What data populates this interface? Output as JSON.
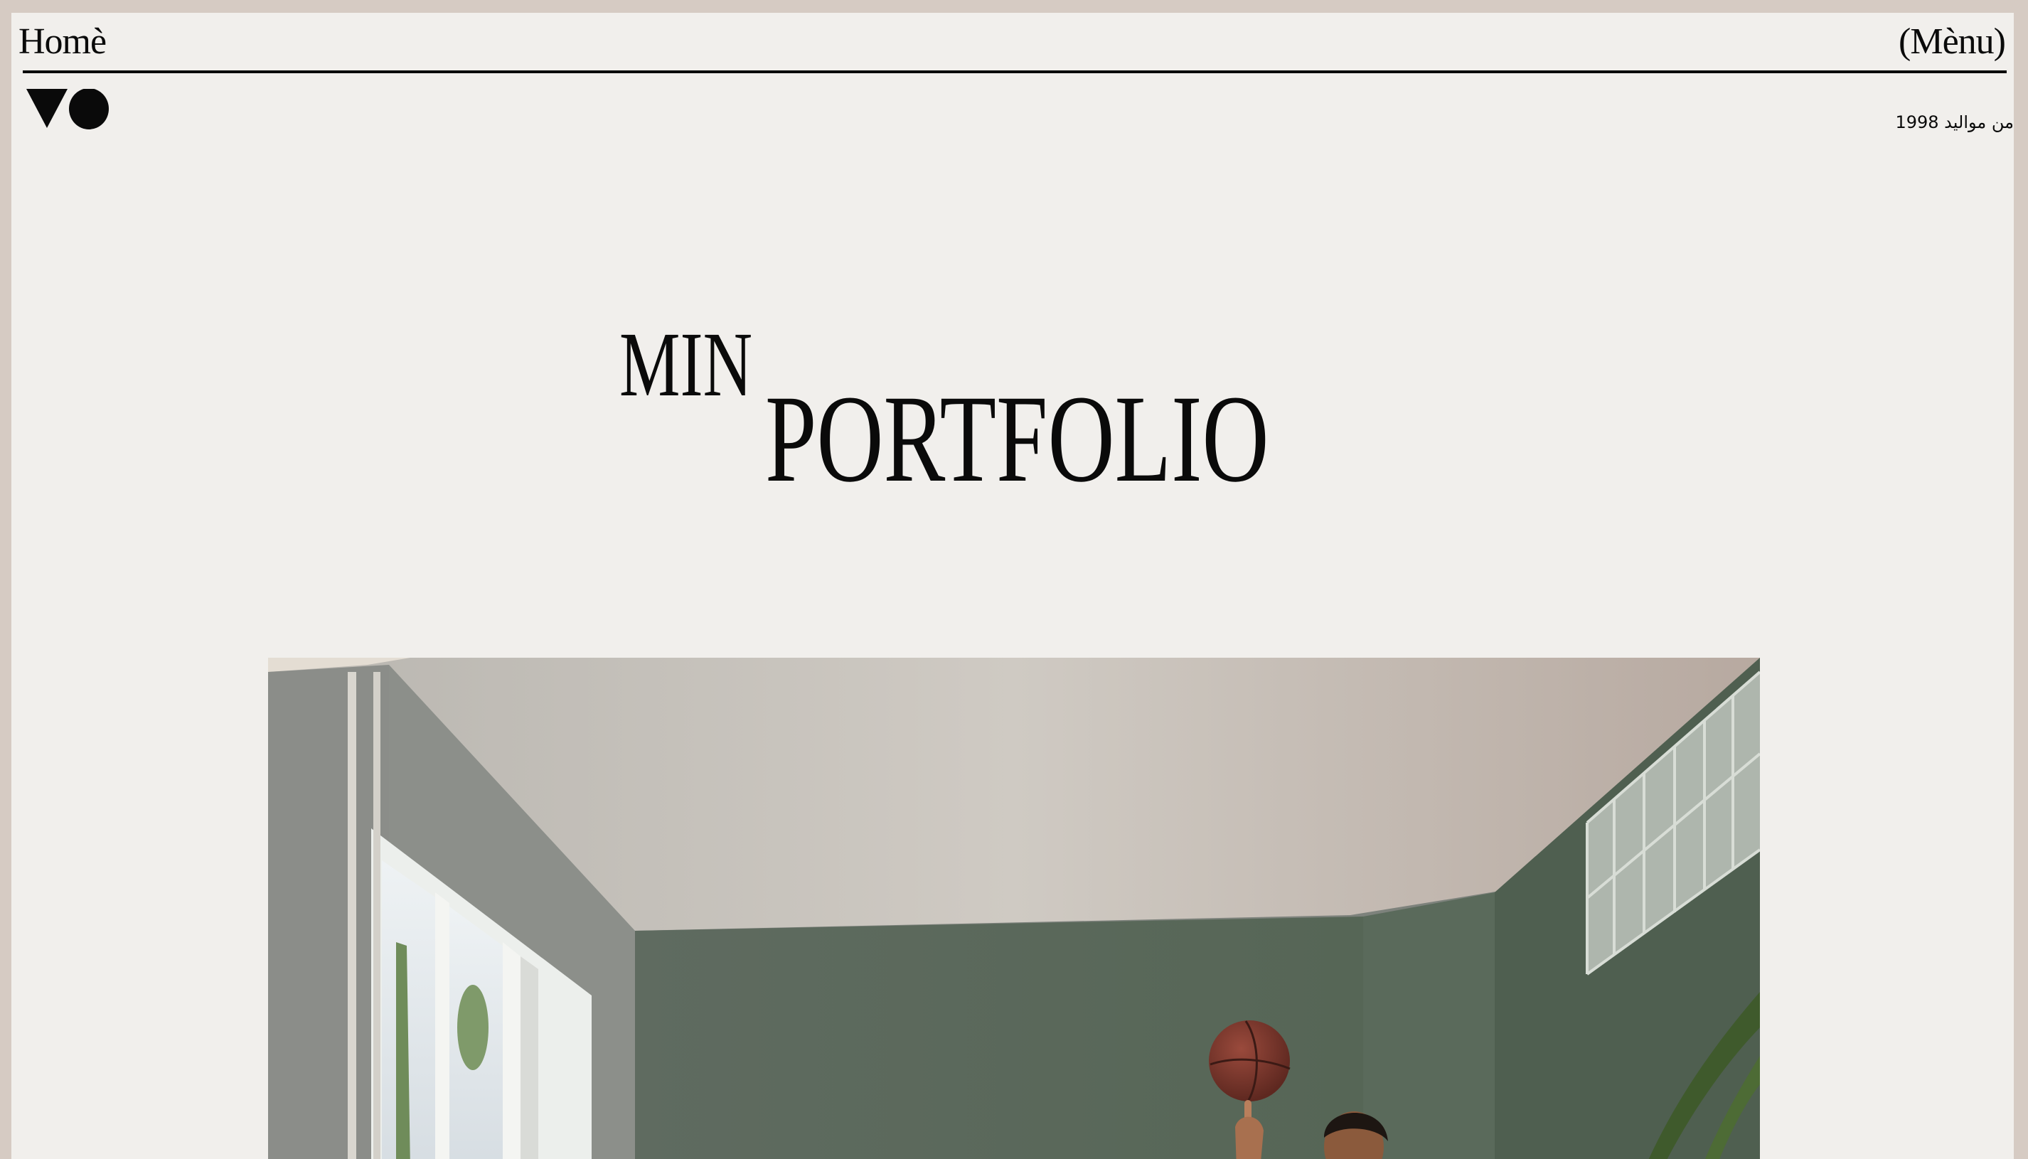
{
  "header": {
    "home_label": "Homè",
    "menu_label": "(Mènu)"
  },
  "logo": {
    "icon": "triangle-circle-logo-icon"
  },
  "tagline": "من مواليد 1998",
  "hero": {
    "title_line1": "MIN",
    "title_line2": "PORTFOLIO"
  },
  "photo": {
    "subject": "person-spinning-basketball-photo"
  },
  "colors": {
    "page_background": "#f1efec",
    "outer_frame": "#d6cbc3",
    "text": "#0a0a0a"
  }
}
